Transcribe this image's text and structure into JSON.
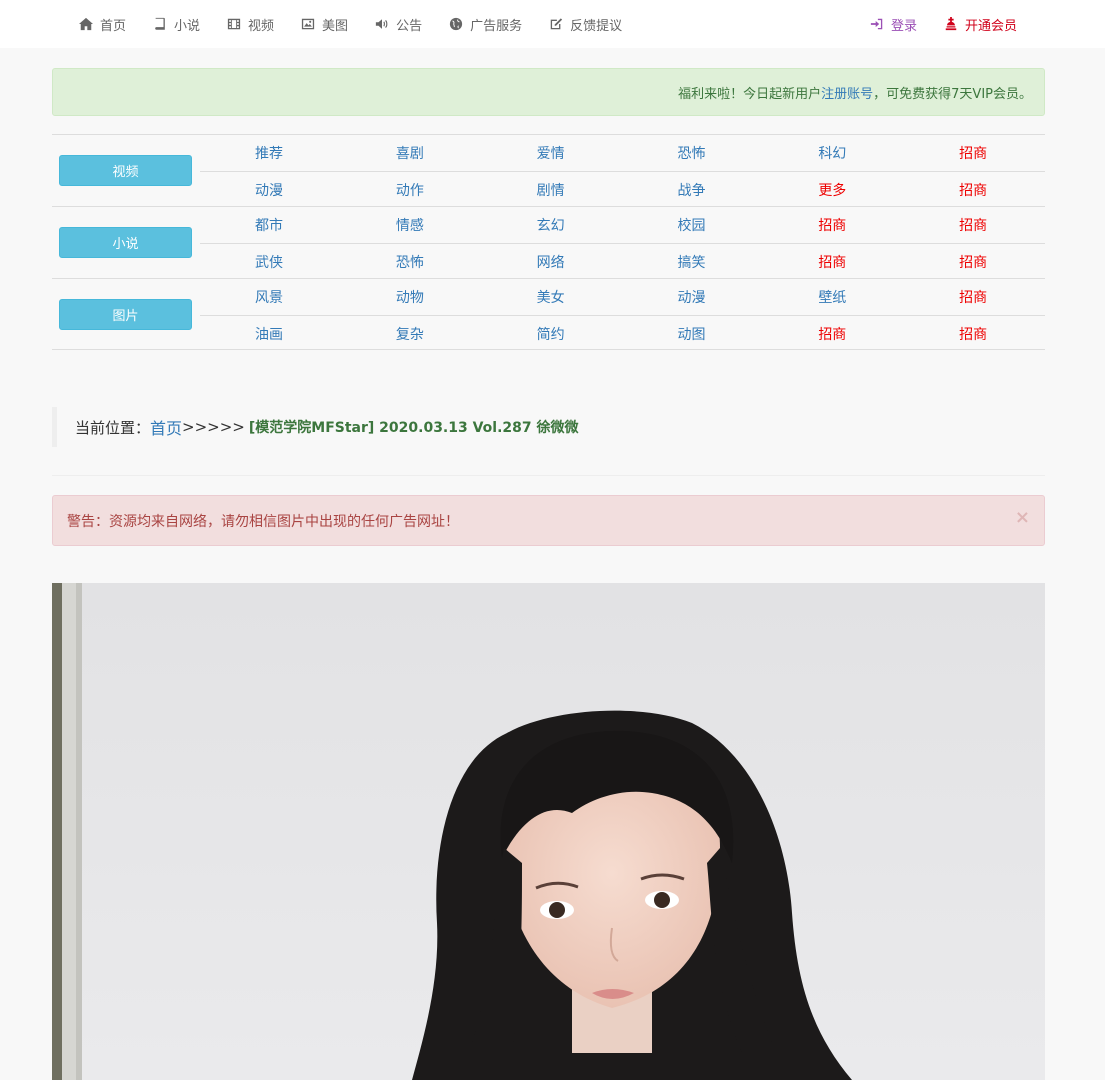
{
  "nav": {
    "items": [
      {
        "label": "首页",
        "icon": "home-icon"
      },
      {
        "label": "小说",
        "icon": "book-icon"
      },
      {
        "label": "视频",
        "icon": "film-icon"
      },
      {
        "label": "美图",
        "icon": "picture-icon"
      },
      {
        "label": "公告",
        "icon": "speaker-icon"
      },
      {
        "label": "广告服务",
        "icon": "globe-icon"
      },
      {
        "label": "反馈提议",
        "icon": "edit-icon"
      }
    ],
    "login": "登录",
    "vip": "开通会员"
  },
  "notice": {
    "prefix": "福利来啦！今日起新用户",
    "link": "注册账号",
    "suffix": "，可免费获得7天VIP会员。"
  },
  "categories": [
    {
      "name": "视频",
      "rows": [
        [
          {
            "t": "推荐"
          },
          {
            "t": "喜剧"
          },
          {
            "t": "爱情"
          },
          {
            "t": "恐怖"
          },
          {
            "t": "科幻"
          },
          {
            "t": "招商",
            "red": true
          }
        ],
        [
          {
            "t": "动漫"
          },
          {
            "t": "动作"
          },
          {
            "t": "剧情"
          },
          {
            "t": "战争"
          },
          {
            "t": "更多",
            "red": true
          },
          {
            "t": "招商",
            "red": true
          }
        ]
      ]
    },
    {
      "name": "小说",
      "rows": [
        [
          {
            "t": "都市"
          },
          {
            "t": "情感"
          },
          {
            "t": "玄幻"
          },
          {
            "t": "校园"
          },
          {
            "t": "招商",
            "red": true
          },
          {
            "t": "招商",
            "red": true
          }
        ],
        [
          {
            "t": "武侠"
          },
          {
            "t": "恐怖"
          },
          {
            "t": "网络"
          },
          {
            "t": "搞笑"
          },
          {
            "t": "招商",
            "red": true
          },
          {
            "t": "招商",
            "red": true
          }
        ]
      ]
    },
    {
      "name": "图片",
      "rows": [
        [
          {
            "t": "风景"
          },
          {
            "t": "动物"
          },
          {
            "t": "美女"
          },
          {
            "t": "动漫"
          },
          {
            "t": "壁纸"
          },
          {
            "t": "招商",
            "red": true
          }
        ],
        [
          {
            "t": "油画"
          },
          {
            "t": "复杂"
          },
          {
            "t": "简约"
          },
          {
            "t": "动图"
          },
          {
            "t": "招商",
            "red": true
          },
          {
            "t": "招商",
            "red": true
          }
        ]
      ]
    }
  ],
  "breadcrumb": {
    "label": "当前位置：",
    "home": "首页",
    "sep": ">>>>>",
    "title": "[模范学院MFStar] 2020.03.13 Vol.287 徐微微"
  },
  "warning": {
    "text": "警告：资源均来自网络，请勿相信图片中出现的任何广告网址！",
    "close": "×"
  },
  "colors": {
    "link": "#337ab7",
    "red": "#e00",
    "info_button": "#5bc0de",
    "success_bg": "#dff0d8",
    "danger_bg": "#f2dede"
  }
}
